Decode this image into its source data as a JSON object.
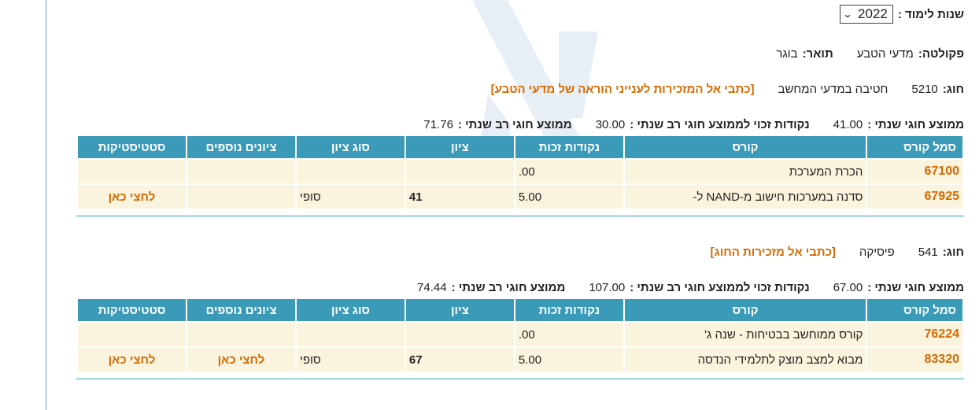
{
  "header": {
    "year_label": "שנות לימוד :",
    "year_value": "2022",
    "faculty_label": "פקולטה:",
    "faculty_value": "מדעי הטבע",
    "degree_label": "תואר:",
    "degree_value": "בוגר"
  },
  "programs": [
    {
      "program_label": "חוג:",
      "program_code": "5210",
      "program_name": "חטיבה במדעי המחשב",
      "contact_link": "[כתבי אל המזכירות לענייני הוראה של מדעי הטבע]",
      "stats": {
        "annual_avg_label": "ממוצע חוגי שנתי :",
        "annual_avg_value": "41.00",
        "credits_label": "נקודות זכוי לממוצע חוגי רב שנתי :",
        "credits_value": "30.00",
        "multi_avg_label": "ממוצע חוגי רב שנתי :",
        "multi_avg_value": "71.76"
      },
      "columns": [
        "סמל קורס",
        "קורס",
        "נקודות זכות",
        "ציון",
        "סוג ציון",
        "ציונים נוספים",
        "סטטיסטיקות"
      ],
      "rows": [
        {
          "code": "67100",
          "course": "הכרת המערכת",
          "credits": ".00",
          "grade": "",
          "kind": "",
          "extra": "",
          "stats": ""
        },
        {
          "code": "67925",
          "course": "סדנה במערכות חישוב מ-NAND ל-",
          "credits": "5.00",
          "grade": "41",
          "kind": "סופי",
          "extra": "",
          "stats": "לחצי כאן"
        }
      ]
    },
    {
      "program_label": "חוג:",
      "program_code": "541",
      "program_name": "פיסיקה",
      "contact_link": "[כתבי אל מזכירות החוג]",
      "stats": {
        "annual_avg_label": "ממוצע חוגי שנתי :",
        "annual_avg_value": "67.00",
        "credits_label": "נקודות זכוי לממוצע חוגי רב שנתי :",
        "credits_value": "107.00",
        "multi_avg_label": "ממוצע חוגי רב שנתי :",
        "multi_avg_value": "74.44"
      },
      "columns": [
        "סמל קורס",
        "קורס",
        "נקודות זכות",
        "ציון",
        "סוג ציון",
        "ציונים נוספים",
        "סטטיסטיקות"
      ],
      "rows": [
        {
          "code": "76224",
          "course": "קורס ממוחשב בבטיחות - שנה ג'",
          "credits": ".00",
          "grade": "",
          "kind": "",
          "extra": "",
          "stats": ""
        },
        {
          "code": "83320",
          "course": "מבוא למצב מוצק לתלמידי הנדסה",
          "credits": "5.00",
          "grade": "67",
          "kind": "סופי",
          "extra": "לחצי כאן",
          "stats": "לחצי כאן"
        }
      ]
    }
  ],
  "colors": {
    "header_bg": "#3a9ab8",
    "row_bg": "#faf3dd",
    "link": "#d46a00"
  }
}
